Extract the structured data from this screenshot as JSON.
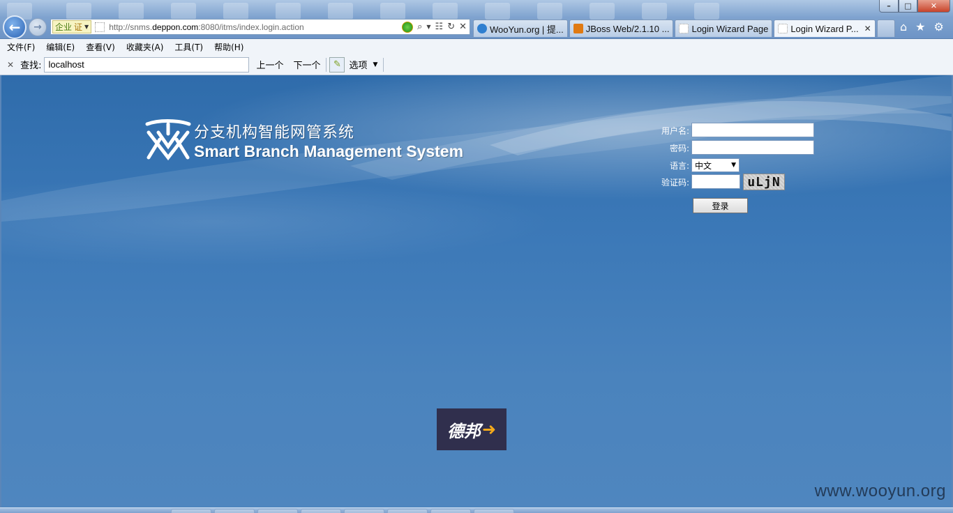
{
  "browser": {
    "address": {
      "cert_label_1": "企业",
      "cert_label_2": "证",
      "url_prefix": "http://snms.",
      "url_domain": "deppon.com",
      "url_suffix": ":8080/itms/index.login.action"
    },
    "tabs": [
      {
        "label": "WooYun.org | 提...",
        "color": "#2f7fd0"
      },
      {
        "label": "JBoss Web/2.1.10 ...",
        "color": "#e07a12"
      },
      {
        "label": "Login Wizard Page",
        "color": "#ffffff"
      },
      {
        "label": "Login Wizard P...",
        "color": "#ffffff"
      }
    ],
    "window_buttons": {
      "minimize": "–",
      "maximize": "□",
      "close": "✕"
    },
    "right_tools": {
      "home": "⌂",
      "favorites": "★",
      "settings": "⚙"
    }
  },
  "menubar": {
    "items": [
      "文件(F)",
      "编辑(E)",
      "查看(V)",
      "收藏夹(A)",
      "工具(T)",
      "帮助(H)"
    ]
  },
  "findbar": {
    "close": "✕",
    "label": "查找:",
    "value": "localhost",
    "prev": "上一个",
    "next": "下一个",
    "options": "选项"
  },
  "page": {
    "title_cn": "分支机构智能网管系统",
    "title_en": "Smart Branch Management System",
    "login": {
      "username_label": "用户名:",
      "password_label": "密码:",
      "language_label": "语言:",
      "language_value": "中文",
      "captcha_label": "验证码:",
      "captcha_text": "uLjN",
      "submit_label": "登录"
    },
    "footer_logo": {
      "text": "德邦",
      "accent": "➜"
    },
    "watermark": "www.wooyun.org"
  }
}
